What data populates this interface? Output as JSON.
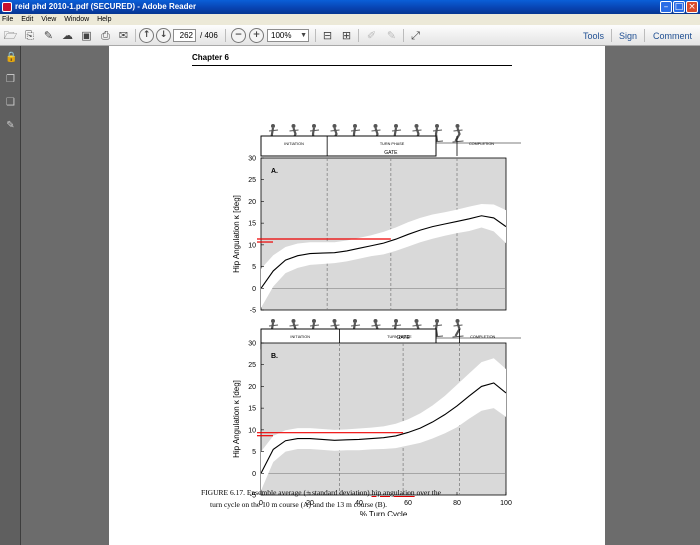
{
  "window": {
    "title": "reid phd 2010-1.pdf (SECURED) - Adobe Reader",
    "min_icon": "minimize-icon",
    "max_icon": "maximize-icon",
    "close_icon": "close-icon"
  },
  "menu": [
    "File",
    "Edit",
    "View",
    "Window",
    "Help"
  ],
  "toolbar": {
    "page_current": "262",
    "page_total": "/ 406",
    "zoom": "100%",
    "tools_label": "Tools",
    "sign_label": "Sign",
    "comment_label": "Comment"
  },
  "document": {
    "chapter_heading": "Chapter 6",
    "caption_line1_pre": "FIGURE 6.17.  Ensemble average (± standard deviation) ",
    "caption_line1_link": "hip angulation",
    "caption_line1_post": " over the",
    "caption_line2": "turn cycle on the 10 m course (A) and the 13 m course (B)."
  },
  "chart_data": [
    {
      "type": "line",
      "panel_label": "A.",
      "phase_labels": [
        "INITIATION",
        "TURN PHASE",
        "COMPLETION"
      ],
      "phase_boundaries": [
        27,
        53,
        80
      ],
      "gate_label": "GATE",
      "ylabel": "Hip Angulation κ [deg]",
      "ylim": [
        -5,
        30
      ],
      "yticks": [
        -5,
        0,
        5,
        10,
        15,
        20,
        25,
        30
      ],
      "xlim": [
        0,
        100
      ],
      "x": [
        0,
        5,
        10,
        15,
        20,
        25,
        30,
        35,
        40,
        45,
        50,
        55,
        60,
        65,
        70,
        75,
        80,
        85,
        90,
        95,
        100
      ],
      "mean": [
        0,
        4,
        6.5,
        7.5,
        8,
        8.1,
        8.2,
        8.6,
        9.2,
        9.8,
        10.4,
        11.3,
        12.4,
        13.4,
        14.2,
        14.8,
        15.4,
        16,
        16.7,
        16.2,
        14.2
      ],
      "upper": [
        4.5,
        7.6,
        9.5,
        10.3,
        10.6,
        10.6,
        10.6,
        11,
        11.6,
        12.2,
        13,
        14,
        15.2,
        16.2,
        17,
        17.5,
        18.1,
        18.8,
        19.4,
        19.3,
        18
      ],
      "lower": [
        -4.5,
        0.4,
        3.5,
        4.7,
        5.4,
        5.6,
        5.8,
        6.2,
        6.8,
        7.4,
        7.8,
        8.6,
        9.6,
        10.6,
        11.4,
        12.1,
        12.7,
        13.2,
        14,
        13.1,
        10.4
      ],
      "reference_line": 11
    },
    {
      "type": "line",
      "panel_label": "B.",
      "phase_labels": [
        "INITIATION",
        "TURN PHASE",
        "COMPLETION"
      ],
      "phase_boundaries": [
        32,
        58,
        81
      ],
      "gate_label": "GATE",
      "ylabel": "Hip Angulation κ [deg]",
      "xlabel": "% Turn Cycle",
      "ylim": [
        -5,
        30
      ],
      "yticks": [
        -5,
        0,
        5,
        10,
        15,
        20,
        25,
        30
      ],
      "xlim": [
        0,
        100
      ],
      "xticks": [
        0,
        20,
        40,
        60,
        80,
        100
      ],
      "x": [
        0,
        5,
        10,
        15,
        20,
        25,
        30,
        35,
        40,
        45,
        50,
        55,
        60,
        65,
        70,
        75,
        80,
        85,
        90,
        95,
        100
      ],
      "mean": [
        0,
        5.5,
        7.5,
        8,
        8,
        7.8,
        7.6,
        7.7,
        7.8,
        8,
        8.2,
        8.6,
        9.4,
        10.4,
        11.8,
        13.5,
        15.5,
        17.8,
        20,
        20.8,
        18.5
      ],
      "upper": [
        5,
        8.6,
        9.9,
        10.4,
        10.4,
        10.2,
        10,
        10.1,
        10.3,
        10.5,
        10.8,
        11.4,
        12.4,
        13.8,
        15.6,
        17.8,
        20.4,
        23,
        25.6,
        26.5,
        24
      ],
      "lower": [
        -4,
        2.6,
        5,
        5.6,
        5.6,
        5.4,
        5.2,
        5.3,
        5.3,
        5.5,
        5.6,
        5.8,
        6.4,
        7,
        8,
        9.2,
        10.6,
        12.6,
        14.4,
        15,
        13
      ],
      "reference_line": 9
    }
  ]
}
